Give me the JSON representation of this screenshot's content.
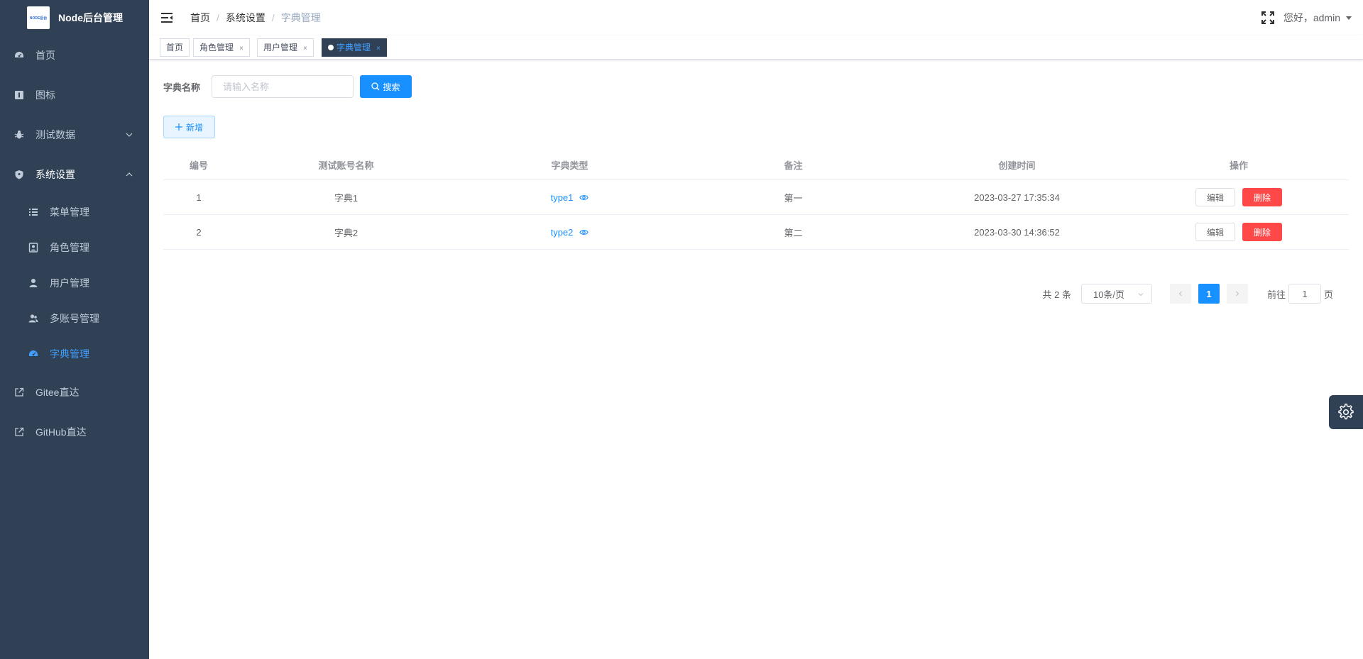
{
  "app": {
    "title": "Node后台管理",
    "logo_text": "NODE后台"
  },
  "sidebar": {
    "items": [
      {
        "label": "首页",
        "icon": "dashboard-icon"
      },
      {
        "label": "图标",
        "icon": "icon-library-icon"
      },
      {
        "label": "测试数据",
        "icon": "bug-icon"
      },
      {
        "label": "系统设置",
        "icon": "shield-icon"
      },
      {
        "label": "菜单管理",
        "icon": "list-icon"
      },
      {
        "label": "角色管理",
        "icon": "role-icon"
      },
      {
        "label": "用户管理",
        "icon": "user-icon"
      },
      {
        "label": "多账号管理",
        "icon": "users-icon"
      },
      {
        "label": "字典管理",
        "icon": "dictionary-icon"
      },
      {
        "label": "Gitee直达",
        "icon": "external-link-icon"
      },
      {
        "label": "GitHub直达",
        "icon": "external-link-icon"
      }
    ]
  },
  "header": {
    "breadcrumb": [
      "首页",
      "系统设置",
      "字典管理"
    ],
    "breadcrumb_sep": "/",
    "user_greeting": "您好，admin"
  },
  "tags": [
    {
      "label": "首页"
    },
    {
      "label": "角色管理"
    },
    {
      "label": "用户管理"
    },
    {
      "label": "字典管理"
    }
  ],
  "tag_close": "×",
  "search": {
    "label": "字典名称",
    "placeholder": "请输入名称",
    "button": "搜索"
  },
  "toolbar": {
    "add_label": "新增"
  },
  "table": {
    "columns": [
      "编号",
      "测试账号名称",
      "字典类型",
      "备注",
      "创建时间",
      "操作"
    ],
    "rows": [
      {
        "id": "1",
        "name": "字典1",
        "type": "type1",
        "note": "第一",
        "created": "2023-03-27 17:35:34"
      },
      {
        "id": "2",
        "name": "字典2",
        "type": "type2",
        "note": "第二",
        "created": "2023-03-30 14:36:52"
      }
    ],
    "edit_label": "编辑",
    "delete_label": "删除"
  },
  "pagination": {
    "total_text": "共 2 条",
    "page_size": "10条/页",
    "current_page": "1",
    "goto_prefix": "前往",
    "goto_value": "1",
    "goto_suffix": "页"
  },
  "colors": {
    "sidebar_bg": "#304156",
    "primary": "#1890ff",
    "danger": "#ff4949",
    "active_menu": "#409eff"
  }
}
